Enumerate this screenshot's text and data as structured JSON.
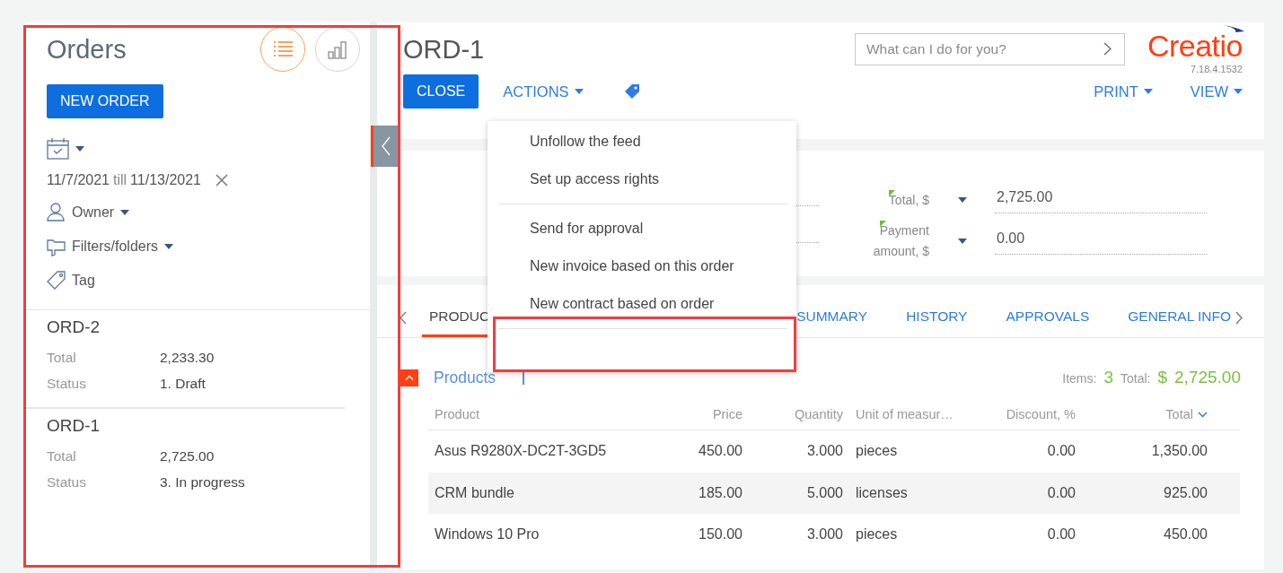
{
  "sidebar": {
    "title": "Orders",
    "view_buttons": [
      {
        "kind": "list",
        "selected": true
      },
      {
        "kind": "chart",
        "selected": false
      }
    ],
    "new_button": "NEW ORDER",
    "date_filter": {
      "from": "11/7/2021",
      "separator": "till",
      "to": "11/13/2021"
    },
    "filters": [
      {
        "kind": "owner",
        "label": "Owner",
        "dropdown": true
      },
      {
        "kind": "folders",
        "label": "Filters/folders",
        "dropdown": true
      },
      {
        "kind": "tag",
        "label": "Tag",
        "dropdown": false
      }
    ],
    "records": [
      {
        "title": "ORD-2",
        "fields": [
          {
            "label": "Total",
            "value": "2,233.30"
          },
          {
            "label": "Status",
            "value": "1. Draft"
          }
        ]
      },
      {
        "title": "ORD-1",
        "fields": [
          {
            "label": "Total",
            "value": "2,725.00"
          },
          {
            "label": "Status",
            "value": "3. In progress"
          }
        ]
      }
    ]
  },
  "page": {
    "title": "ORD-1",
    "search": {
      "placeholder": "What can I do for you?"
    },
    "logo": "Creatio",
    "version": "7.18.4.1532",
    "buttons": [
      {
        "kind": "primary",
        "label": "CLOSE"
      },
      {
        "kind": "menu",
        "label": "ACTIONS"
      },
      {
        "kind": "tag"
      }
    ],
    "right_buttons": [
      {
        "kind": "menu",
        "label": "PRINT"
      },
      {
        "kind": "menu",
        "label": "VIEW"
      }
    ]
  },
  "actions_menu": [
    {
      "kind": "item",
      "label": "Unfollow the feed"
    },
    {
      "kind": "item",
      "label": "Set up access rights"
    },
    {
      "kind": "divider"
    },
    {
      "kind": "item",
      "label": "Send for approval"
    },
    {
      "kind": "item",
      "label": "New invoice based on this order"
    },
    {
      "kind": "item",
      "label": "New contract based on order"
    },
    {
      "kind": "divider"
    }
  ],
  "fields": [
    {
      "label": "Total, $",
      "value": "2,725.00"
    },
    {
      "label": "Payment amount, $",
      "value": "0.00"
    }
  ],
  "tabs": [
    {
      "label": "PRODUC",
      "selected": true
    },
    {
      "label": "SUMMARY",
      "selected": false
    },
    {
      "label": "HISTORY",
      "selected": false
    },
    {
      "label": "APPROVALS",
      "selected": false
    },
    {
      "label": "GENERAL INFO",
      "selected": false
    }
  ],
  "products": {
    "title": "Products",
    "expanded": true,
    "items_label": "Items:",
    "items_count": "3",
    "total_label": "Total:",
    "currency": "$",
    "total": "2,725.00",
    "columns": [
      {
        "label": "Product",
        "sorted": false
      },
      {
        "label": "Price",
        "sorted": false
      },
      {
        "label": "Quantity",
        "sorted": false
      },
      {
        "label": "Unit of measur…",
        "sorted": false
      },
      {
        "label": "Discount, %",
        "sorted": false
      },
      {
        "label": "Total",
        "sorted": true
      }
    ],
    "rows": [
      [
        "Asus R9280X-DC2T-3GD5",
        "450.00",
        "3.000",
        "pieces",
        "0.00",
        "1,350.00"
      ],
      [
        "CRM bundle",
        "185.00",
        "5.000",
        "licenses",
        "0.00",
        "925.00"
      ],
      [
        "Windows 10 Pro",
        "150.00",
        "3.000",
        "pieces",
        "0.00",
        "450.00"
      ]
    ]
  }
}
